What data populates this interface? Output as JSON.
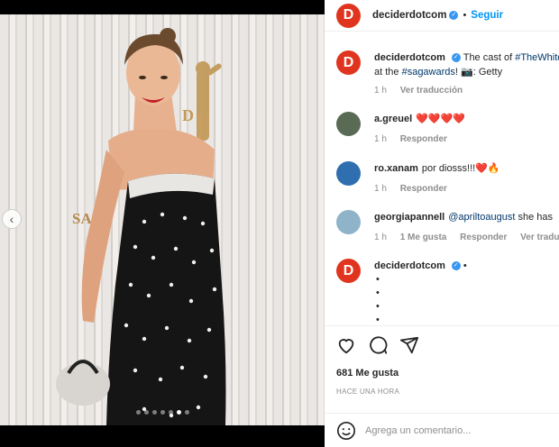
{
  "header": {
    "username": "deciderdotcom",
    "separator": "•",
    "follow_label": "Seguir",
    "logo_letter": "D"
  },
  "caption": {
    "username": "deciderdotcom",
    "text_before": "The cast of ",
    "hashtag1": "#TheWhite",
    "line2_before": "at the ",
    "hashtag2": "#sagawards",
    "line2_after": "! 📷: Getty",
    "time": "1 h",
    "translate": "Ver traducción"
  },
  "comments": [
    {
      "username": "a.greuel",
      "text": "❤️❤️❤️❤️",
      "time": "1 h",
      "reply": "Responder"
    },
    {
      "username": "ro.xanam",
      "text": "por diosss!!!❤️🔥",
      "time": "1 h",
      "reply": "Responder"
    },
    {
      "username": "georgiapannell",
      "mention": "@apriltoaugust",
      "text": " she has",
      "time": "1 h",
      "likes": "1 Me gusta",
      "reply": "Responder",
      "translate": "Ver traducción"
    }
  ],
  "reply_post": {
    "username": "deciderdotcom",
    "suffix": "•",
    "bullets": [
      "•",
      "•",
      "•",
      "•"
    ]
  },
  "likes_count": "681 Me gusta",
  "posted_ago": "HACE UNA HORA",
  "composer": {
    "placeholder": "Agrega un comentario..."
  },
  "carousel": {
    "prev_arrow": "‹",
    "dots_total": 7,
    "dots_active": 6
  },
  "photo_text": {
    "backdrop_sag": "SAG"
  },
  "colors": {
    "brand": "#e0341f",
    "follow": "#0095f6",
    "verified": "#3897f0",
    "meta": "#8e8e8e"
  }
}
